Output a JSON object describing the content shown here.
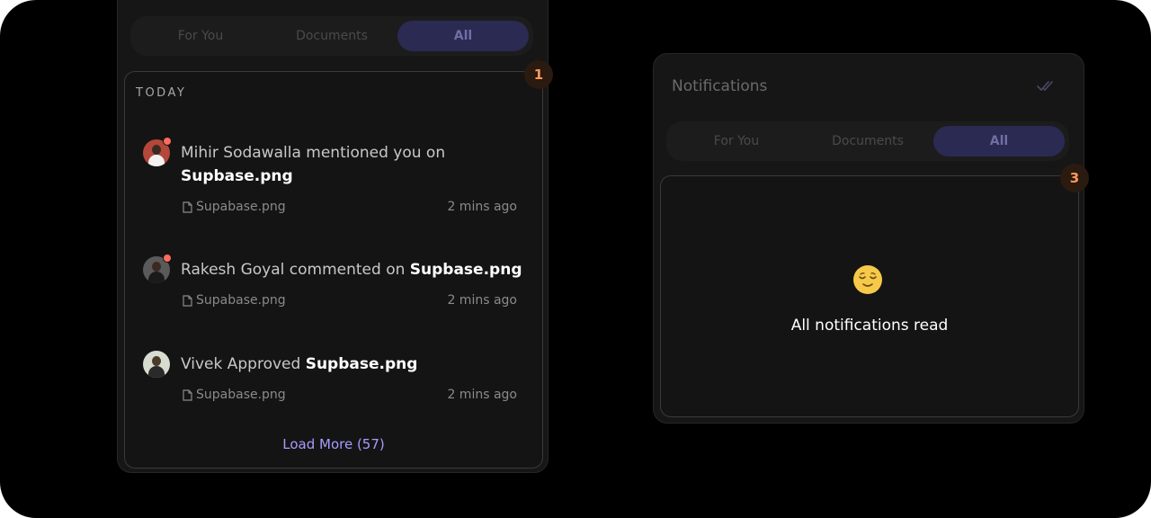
{
  "left_panel": {
    "tabs": [
      {
        "label": "For You",
        "active": false
      },
      {
        "label": "Documents",
        "active": false
      },
      {
        "label": "All",
        "active": true
      }
    ],
    "section_label": "TODAY",
    "badge": "1",
    "notifications": [
      {
        "text_prefix": "Mihir Sodawalla mentioned you on ",
        "text_bold": "Supbase.png",
        "file": "Supabase.png",
        "time": "2 mins ago",
        "unread": true
      },
      {
        "text_prefix": "Rakesh Goyal commented on ",
        "text_bold": "Supbase.png",
        "file": "Supabase.png",
        "time": "2 mins ago",
        "unread": true
      },
      {
        "text_prefix": "Vivek Approved ",
        "text_bold": "Supbase.png",
        "file": "Supabase.png",
        "time": "2 mins ago",
        "unread": false
      }
    ],
    "load_more": "Load More (57)"
  },
  "right_panel": {
    "title": "Notifications",
    "tabs": [
      {
        "label": "For You",
        "active": false
      },
      {
        "label": "Documents",
        "active": false
      },
      {
        "label": "All",
        "active": true
      }
    ],
    "badge": "3",
    "empty_emoji": "relieved-face-icon",
    "empty_text": "All notifications read"
  },
  "colors": {
    "accent": "#a79bff",
    "active_tab_bg": "#2a2a52",
    "unread_dot": "#ff6b5e",
    "badge_text": "#ff9a5a"
  }
}
